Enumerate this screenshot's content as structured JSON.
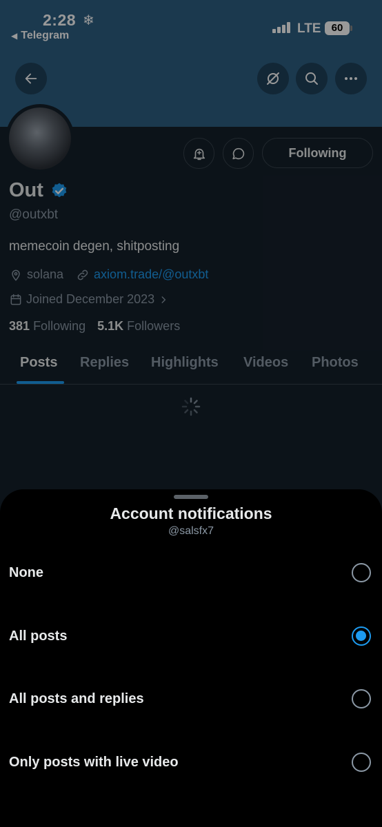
{
  "status_bar": {
    "time": "2:28",
    "back_app": "Telegram",
    "network": "LTE",
    "battery": "60"
  },
  "profile": {
    "name": "Out",
    "handle": "@outxbt",
    "bio": "memecoin degen, shitposting",
    "location": "solana",
    "website": "axiom.trade/@outxbt",
    "joined": "Joined December 2023",
    "following_count": "381",
    "following_label": "Following",
    "followers_count": "5.1K",
    "followers_label": "Followers",
    "follow_button": "Following",
    "tabs": [
      "Posts",
      "Replies",
      "Highlights",
      "Videos",
      "Photos"
    ],
    "active_tab": "Posts"
  },
  "sheet": {
    "title": "Account notifications",
    "subtitle": "@salsfx7",
    "options": [
      {
        "label": "None",
        "selected": false
      },
      {
        "label": "All posts",
        "selected": true
      },
      {
        "label": "All posts and replies",
        "selected": false
      },
      {
        "label": "Only posts with live video",
        "selected": false
      }
    ]
  },
  "colors": {
    "accent": "#1d9bf0",
    "banner": "#2e5f83",
    "background": "#15202b",
    "sheet": "#000000"
  },
  "icons": [
    "back-arrow-icon",
    "hide-reposts-icon",
    "search-icon",
    "more-icon",
    "notification-bell-icon",
    "message-icon",
    "verified-badge-icon",
    "location-icon",
    "link-icon",
    "calendar-icon",
    "chevron-right-icon",
    "loading-spinner-icon"
  ]
}
